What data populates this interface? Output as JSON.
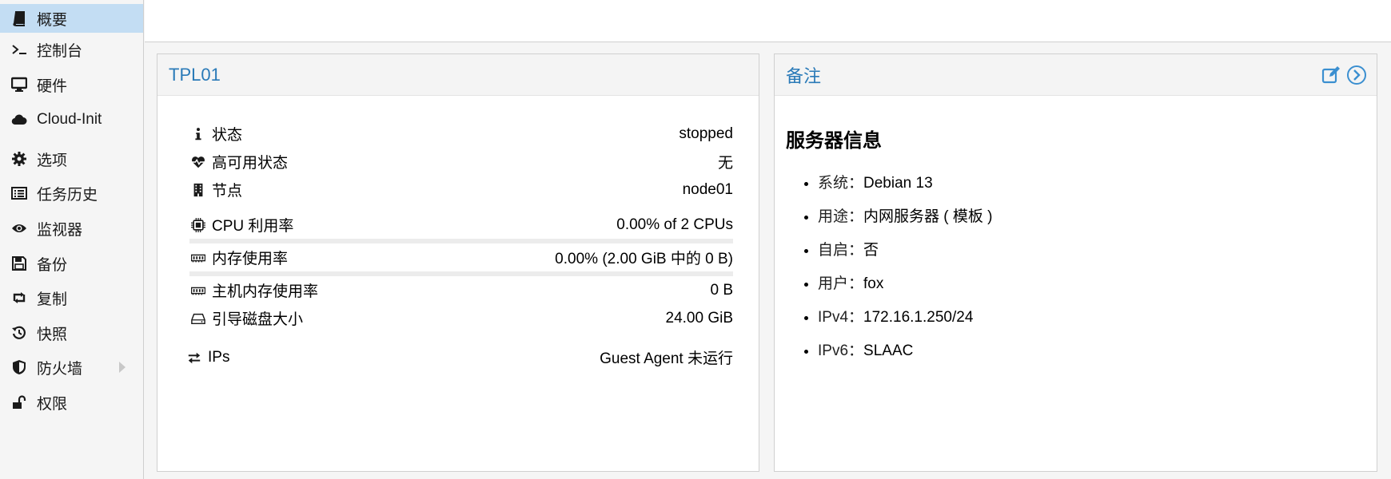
{
  "sidebar": {
    "items": [
      {
        "label": "概要",
        "icon": "book-icon",
        "active": true
      },
      {
        "label": "控制台",
        "icon": "terminal-icon"
      },
      {
        "label": "硬件",
        "icon": "monitor-icon"
      },
      {
        "label": "Cloud-Init",
        "icon": "cloud-icon"
      },
      {
        "label": "选项",
        "icon": "gear-icon"
      },
      {
        "label": "任务历史",
        "icon": "list-icon"
      },
      {
        "label": "监视器",
        "icon": "eye-icon"
      },
      {
        "label": "备份",
        "icon": "floppy-icon"
      },
      {
        "label": "复制",
        "icon": "retweet-icon"
      },
      {
        "label": "快照",
        "icon": "history-icon"
      },
      {
        "label": "防火墙",
        "icon": "shield-icon",
        "has_submenu": true
      },
      {
        "label": "权限",
        "icon": "unlock-icon"
      }
    ]
  },
  "status_panel": {
    "title": "TPL01",
    "rows": [
      {
        "label": "状态",
        "value": "stopped",
        "icon": "info-icon"
      },
      {
        "label": "高可用状态",
        "value": "无",
        "icon": "heartbeat-icon"
      },
      {
        "label": "节点",
        "value": "node01",
        "icon": "building-icon"
      },
      {
        "label": "CPU 利用率",
        "value": "0.00% of 2 CPUs",
        "icon": "cpu-icon"
      },
      {
        "label": "内存使用率",
        "value": "0.00% (2.00 GiB 中的 0 B)",
        "icon": "memory-icon"
      },
      {
        "label": "主机内存使用率",
        "value": "0 B",
        "icon": "memory-icon"
      },
      {
        "label": "引导磁盘大小",
        "value": "24.00 GiB",
        "icon": "hdd-icon"
      },
      {
        "label": "IPs",
        "value": "Guest Agent 未运行",
        "icon": "exchange-icon"
      }
    ],
    "cpu_usage_fraction": 0.0,
    "memory_usage_fraction": 0.0
  },
  "notes_panel": {
    "title": "备注",
    "heading": "服务器信息",
    "items": [
      {
        "label": "系统：",
        "value": "Debian 13"
      },
      {
        "label": "用途：",
        "value": "内网服务器 ( 模板 )"
      },
      {
        "label": "自启：",
        "value": "否"
      },
      {
        "label": "用户：",
        "value": "fox"
      },
      {
        "label": "IPv4：",
        "value": "172.16.1.250/24"
      },
      {
        "label": "IPv6：",
        "value": "SLAAC"
      }
    ]
  },
  "colors": {
    "accent": "#2a7ab8",
    "active_nav": "#c3ddf3",
    "icon_blue": "#3b8fd0"
  }
}
